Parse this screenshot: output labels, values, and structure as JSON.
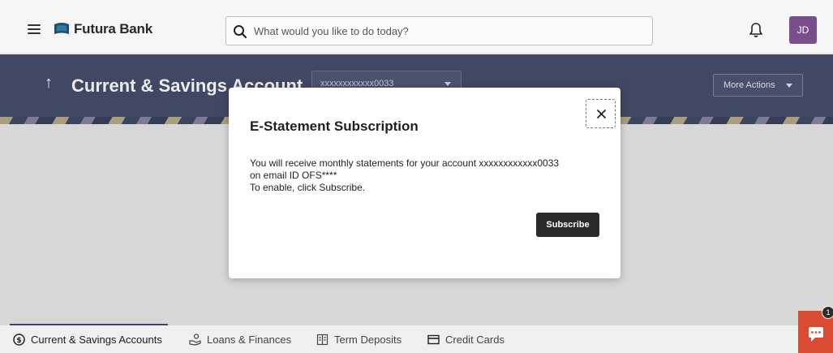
{
  "header": {
    "brand": "Futura Bank",
    "search_placeholder": "What would you like to do today?",
    "avatar_initials": "JD",
    "avatar_color": "#7a4e8c"
  },
  "banner": {
    "title": "Current & Savings Account",
    "account_value": "xxxxxxxxxxxx0033",
    "more_actions_label": "More Actions",
    "color": "#3f4565"
  },
  "modal": {
    "title": "E-Statement Subscription",
    "line1": "You will receive monthly statements for your account xxxxxxxxxxxx0033",
    "line2": "on email ID OFS****",
    "line3": "To enable, click Subscribe.",
    "subscribe_label": "Subscribe"
  },
  "tabs": [
    {
      "label": "Current & Savings Accounts",
      "icon": "dollar-circle-icon",
      "active": true
    },
    {
      "label": "Loans & Finances",
      "icon": "hand-coins-icon",
      "active": false
    },
    {
      "label": "Term Deposits",
      "icon": "deposit-book-icon",
      "active": false
    },
    {
      "label": "Credit Cards",
      "icon": "credit-card-icon",
      "active": false
    }
  ],
  "chat": {
    "badge": "1",
    "color": "#d94b33"
  }
}
